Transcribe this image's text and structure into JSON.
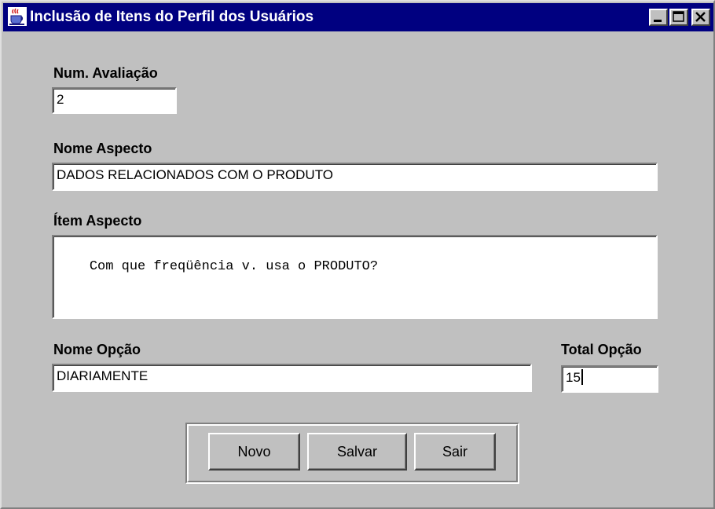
{
  "window": {
    "title": "Inclusão de Itens do Perfil dos Usuários",
    "icon": "java-coffee-cup-icon",
    "title_bar_color": "#000080",
    "face_color": "#c0c0c0"
  },
  "form": {
    "num_avaliacao": {
      "label": "Num. Avaliação",
      "value": "2"
    },
    "nome_aspecto": {
      "label": "Nome Aspecto",
      "value": "DADOS RELACIONADOS COM O PRODUTO"
    },
    "item_aspecto": {
      "label": "Ítem Aspecto",
      "value": "Com que freqüência v. usa o PRODUTO?"
    },
    "nome_opcao": {
      "label": "Nome Opção",
      "value": "DIARIAMENTE"
    },
    "total_opcao": {
      "label": "Total Opção",
      "value": "15"
    }
  },
  "buttons": {
    "novo": "Novo",
    "salvar": "Salvar",
    "sair": "Sair"
  }
}
